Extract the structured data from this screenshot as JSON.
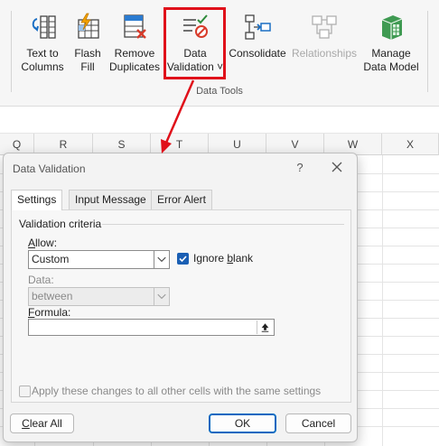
{
  "ribbon": {
    "buttons": [
      {
        "line1": "Text to",
        "line2": "Columns",
        "icon": "text-to-columns-icon",
        "enabled": true
      },
      {
        "line1": "Flash",
        "line2": "Fill",
        "icon": "flash-fill-icon",
        "enabled": true
      },
      {
        "line1": "Remove",
        "line2": "Duplicates",
        "icon": "remove-duplicates-icon",
        "enabled": true
      },
      {
        "line1": "Data",
        "line2": "Validation ˅",
        "icon": "data-validation-icon",
        "enabled": true
      },
      {
        "line1": "Consolidate",
        "line2": "",
        "icon": "consolidate-icon",
        "enabled": true
      },
      {
        "line1": "Relationships",
        "line2": "",
        "icon": "relationships-icon",
        "enabled": false
      },
      {
        "line1": "Manage",
        "line2": "Data Model",
        "icon": "data-model-icon",
        "enabled": true
      }
    ],
    "group_label": "Data Tools",
    "highlight_color": "#e0101a"
  },
  "sheet": {
    "columns": [
      "Q",
      "R",
      "S",
      "T",
      "U",
      "V",
      "W",
      "X"
    ]
  },
  "dialog": {
    "title": "Data Validation",
    "help": "?",
    "tabs": [
      "Settings",
      "Input Message",
      "Error Alert"
    ],
    "active_tab": "Settings",
    "criteria_label": "Validation criteria",
    "allow": {
      "label": "Allow:",
      "value": "Custom"
    },
    "ignore_blank": {
      "label": "Ignore blank",
      "checked": true
    },
    "data": {
      "label": "Data:",
      "value": "between",
      "enabled": false
    },
    "formula": {
      "label": "Formula:",
      "value": ""
    },
    "apply_all": {
      "label": "Apply these changes to all other cells with the same settings",
      "checked": false
    },
    "buttons": {
      "clear": "Clear All",
      "ok": "OK",
      "cancel": "Cancel"
    },
    "accent_color": "#1a5fb4"
  }
}
